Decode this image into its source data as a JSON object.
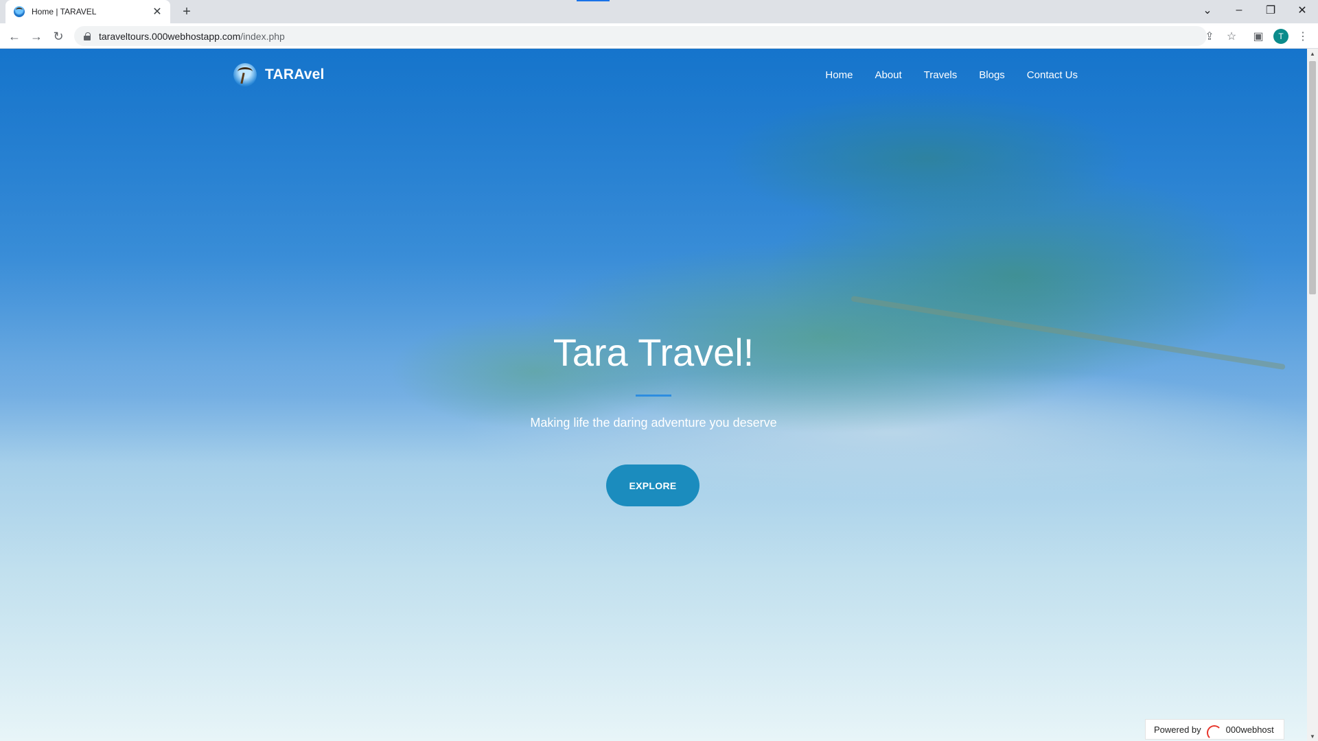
{
  "browser": {
    "tab_title": "Home | TARAVEL",
    "url_host": "taraveltours.000webhostapp.com",
    "url_path": "/index.php",
    "profile_initial": "T"
  },
  "site": {
    "brand": "TARAvel",
    "nav": [
      "Home",
      "About",
      "Travels",
      "Blogs",
      "Contact Us"
    ],
    "hero_title": "Tara Travel!",
    "hero_subtitle": "Making life the daring adventure you deserve",
    "cta_label": "EXPLORE",
    "accent_color": "#1b8cbe"
  },
  "footer_badge": {
    "prefix": "Powered by",
    "brand": "000webhost"
  }
}
